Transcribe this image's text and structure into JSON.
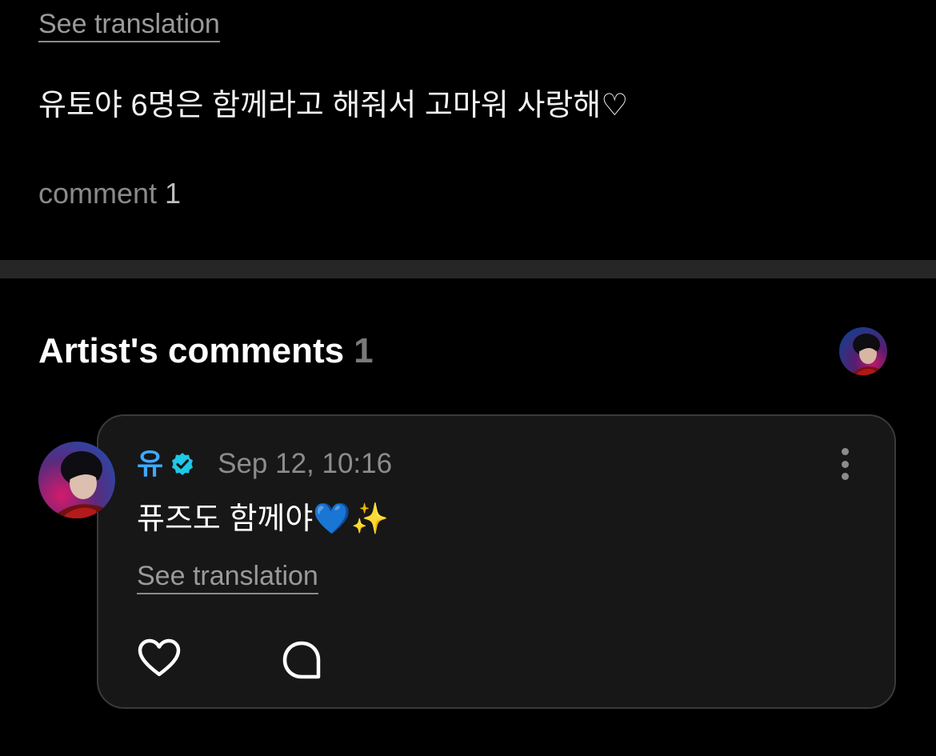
{
  "post": {
    "see_translation": "See translation",
    "text": "유토야 6명은 함께라고 해줘서 고마워 사랑해♡",
    "comment_label": "comment",
    "comment_count": "1"
  },
  "artist_comments": {
    "title": "Artist's comments",
    "count": "1",
    "items": [
      {
        "author": "유",
        "timestamp": "Sep 12, 10:16",
        "text": "퓨즈도 함께야💙✨",
        "see_translation": "See translation"
      }
    ]
  },
  "icons": {
    "verified": "verified-badge-icon",
    "more": "more-vertical-icon",
    "like": "heart-outline-icon",
    "reply": "comment-bubble-icon"
  },
  "colors": {
    "background": "#000000",
    "card_background": "#171717",
    "divider": "#262626",
    "author": "#3fa9ff",
    "verified_badge": "#1ec8e6",
    "muted_text": "#8c8c8c"
  }
}
